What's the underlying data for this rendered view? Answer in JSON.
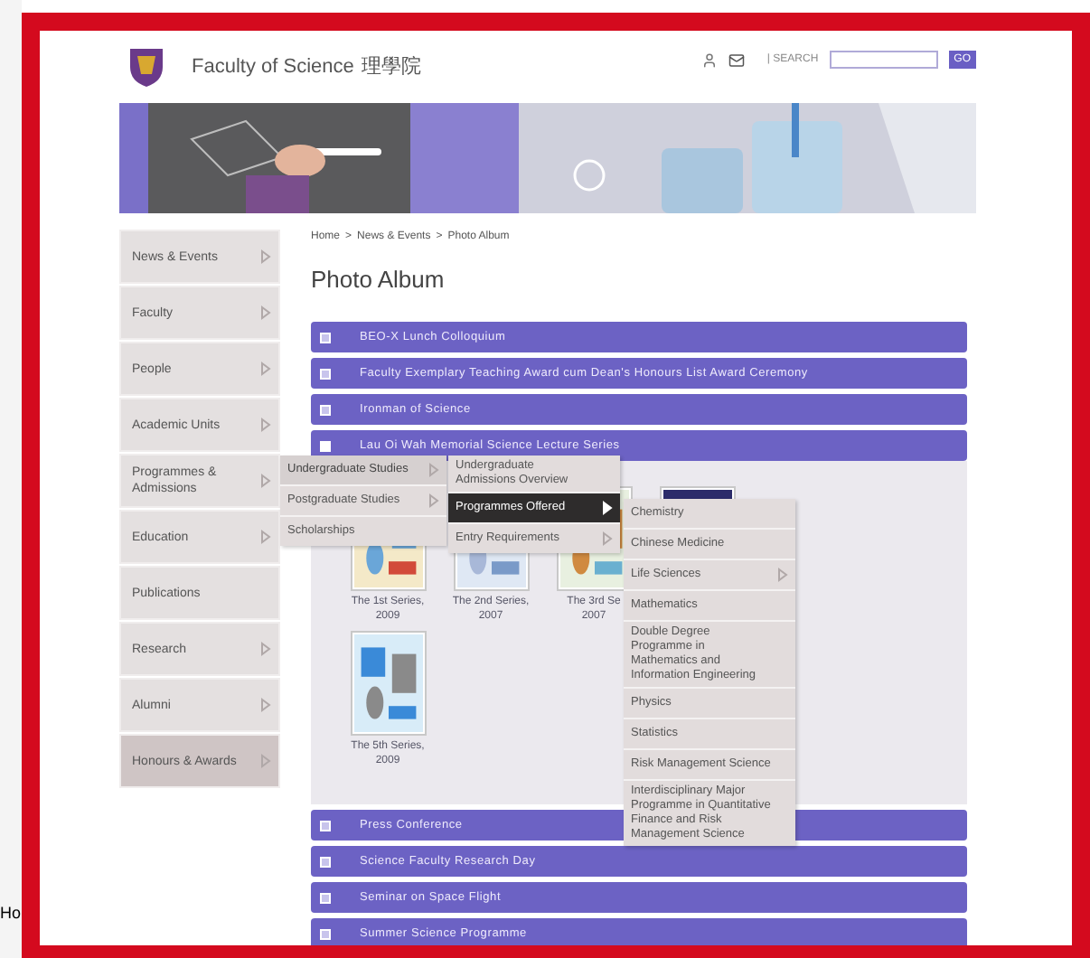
{
  "background_window": {
    "texts": [
      "Ho"
    ]
  },
  "header": {
    "title": "Faculty of Science",
    "title_cjk": "理學院",
    "search_label": "| SEARCH",
    "search_button": "GO"
  },
  "sidebar": {
    "items": [
      {
        "label": "News & Events",
        "has_arrow": true,
        "selected": false
      },
      {
        "label": "Faculty",
        "has_arrow": true,
        "selected": false
      },
      {
        "label": "People",
        "has_arrow": true,
        "selected": false
      },
      {
        "label": "Academic Units",
        "has_arrow": true,
        "selected": false
      },
      {
        "label": "Programmes & Admissions",
        "has_arrow": true,
        "selected": false
      },
      {
        "label": "Education",
        "has_arrow": true,
        "selected": false
      },
      {
        "label": "Publications",
        "has_arrow": false,
        "selected": false
      },
      {
        "label": "Research",
        "has_arrow": true,
        "selected": false
      },
      {
        "label": "Alumni",
        "has_arrow": true,
        "selected": false
      },
      {
        "label": "Honours & Awards",
        "has_arrow": true,
        "selected": true
      }
    ]
  },
  "breadcrumb": {
    "items": [
      "Home",
      "News & Events",
      "Photo Album"
    ],
    "separator": ">"
  },
  "page_title": "Photo Album",
  "sections": [
    {
      "label": "BEO-X Lunch Colloquium",
      "expanded": false
    },
    {
      "label": "Faculty Exemplary Teaching Award cum Dean's Honours List Award Ceremony",
      "expanded": false
    },
    {
      "label": "Ironman of Science",
      "expanded": false
    },
    {
      "label": "Lau Oi Wah Memorial Science Lecture Series",
      "expanded": true,
      "photos": [
        {
          "kind": "picture",
          "caption": [
            "The 1st Series,",
            "2009"
          ]
        },
        {
          "kind": "picture",
          "caption": [
            "The 2nd Series,",
            "2007"
          ]
        },
        {
          "kind": "picture",
          "caption": [
            "The 3rd Se",
            "2007"
          ]
        },
        {
          "kind": "picture"
        },
        {
          "kind": "picture",
          "caption": [
            "The 5th Series,",
            "2009"
          ]
        }
      ]
    },
    {
      "label": "Press Conference",
      "expanded": false
    },
    {
      "label": "Science Faculty Research Day",
      "expanded": false
    },
    {
      "label": "Seminar on Space Flight",
      "expanded": false
    },
    {
      "label": "Summer Science Programme",
      "expanded": false
    }
  ],
  "menus": [
    {
      "items": [
        {
          "label": "Undergraduate Studies",
          "has_arrow": true,
          "selected": true
        },
        {
          "label": "Postgraduate Studies",
          "has_arrow": true,
          "selected": false
        },
        {
          "label": "Scholarships",
          "has_arrow": false,
          "selected": false
        }
      ]
    },
    {
      "items": [
        {
          "label": "Undergraduate Admissions Overview",
          "has_arrow": false,
          "selected": false
        },
        {
          "label": "Programmes Offered",
          "has_arrow": true,
          "selected": true
        },
        {
          "label": "Entry Requirements",
          "has_arrow": true,
          "selected": false
        }
      ]
    },
    {
      "items": [
        {
          "label": "Chemistry",
          "has_arrow": false,
          "selected": false
        },
        {
          "label": "Chinese Medicine",
          "has_arrow": false,
          "selected": false
        },
        {
          "label": "Life Sciences",
          "has_arrow": true,
          "selected": false
        },
        {
          "label": "Mathematics",
          "has_arrow": false,
          "selected": false
        },
        {
          "label": "Double Degree Programme in Mathematics and Information Engineering",
          "has_arrow": false,
          "selected": false
        },
        {
          "label": "Physics",
          "has_arrow": false,
          "selected": false
        },
        {
          "label": "Statistics",
          "has_arrow": false,
          "selected": false
        },
        {
          "label": "Risk Management Science",
          "has_arrow": false,
          "selected": false
        },
        {
          "label": "Interdisciplinary Major Programme in Quantitative Finance and Risk Management Science",
          "has_arrow": false,
          "selected": false
        }
      ]
    }
  ]
}
